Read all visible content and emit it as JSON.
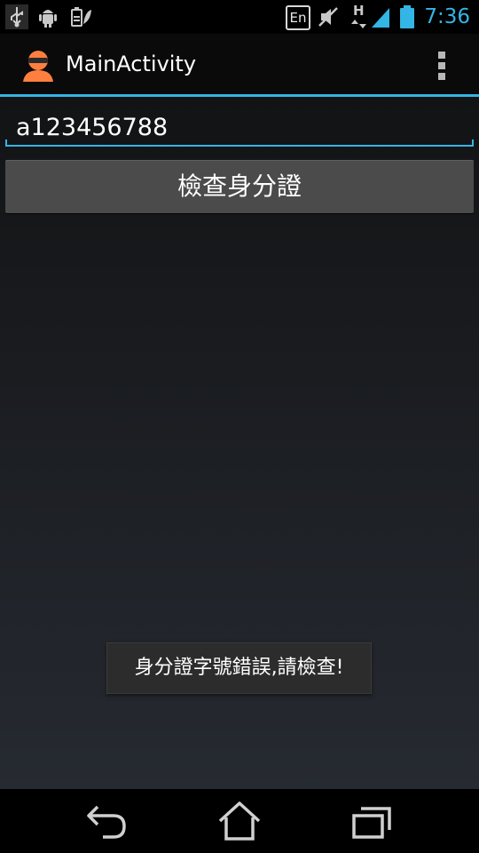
{
  "status_bar": {
    "time": "7:36",
    "input_language": "En",
    "signal_type": "H",
    "icons": [
      "usb-icon",
      "android-debug-icon",
      "battery-saver-icon",
      "muted-icon",
      "signal-icon",
      "battery-icon"
    ]
  },
  "action_bar": {
    "title": "MainActivity",
    "icon": "app-icon",
    "overflow_icon": "overflow-menu-icon"
  },
  "form": {
    "id_input_value": "a123456788",
    "check_button_label": "檢查身分證"
  },
  "toast": {
    "message": "身分證字號錯誤,請檢查!"
  },
  "nav_bar": {
    "icons": [
      "back-icon",
      "home-icon",
      "recents-icon"
    ]
  },
  "colors": {
    "accent": "#33b5e5",
    "app_icon": "#ff7f3f",
    "content_bg_top": "#121315",
    "content_bg_bottom": "#262a31",
    "button_bg": "#4b4b4b"
  }
}
